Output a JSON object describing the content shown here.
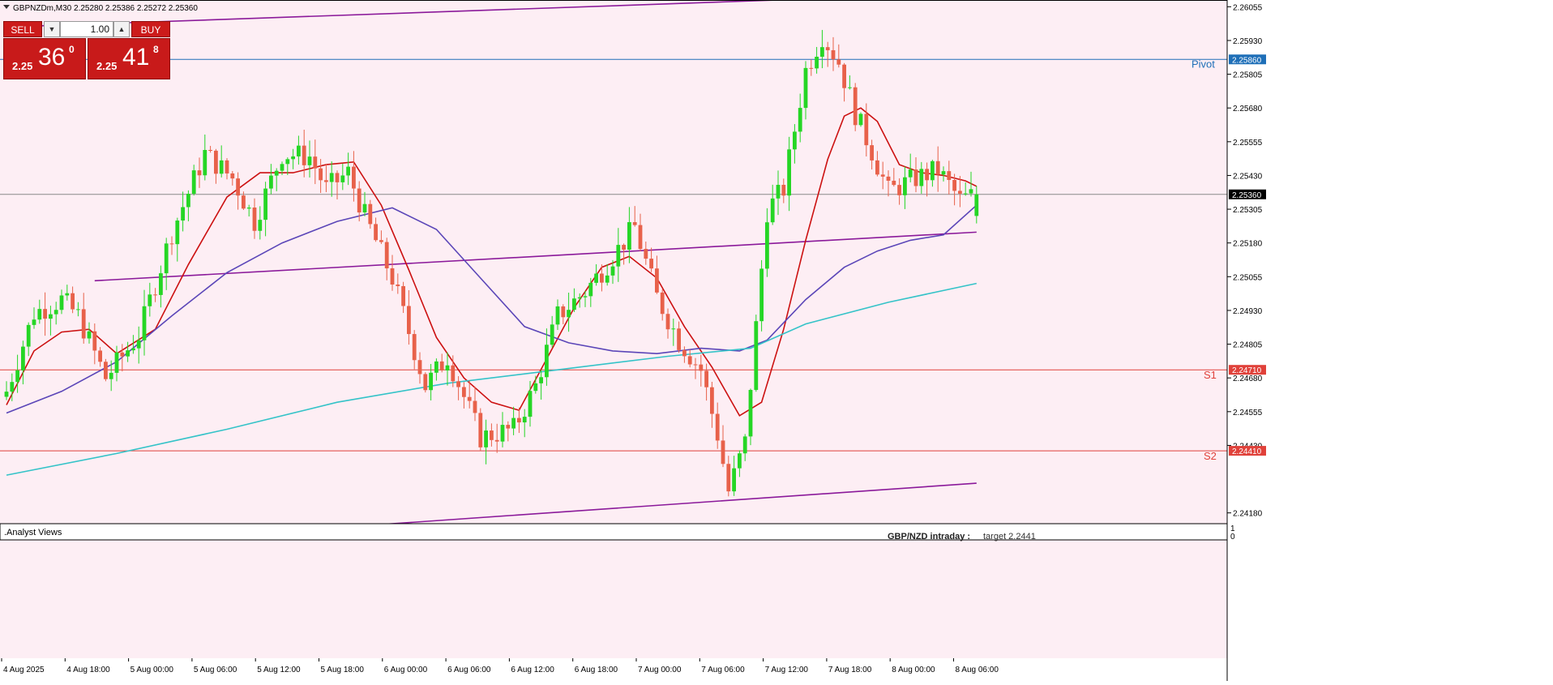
{
  "header": {
    "symbol_line": "GBPNZDm,M30  2.25280 2.25386 2.25272 2.25360"
  },
  "trade_panel": {
    "sell_label": "SELL",
    "buy_label": "BUY",
    "lot_value": "1.00",
    "sell_small": "2.25",
    "sell_big": "36",
    "sell_sup": "0",
    "buy_small": "2.25",
    "buy_big": "41",
    "buy_sup": "8",
    "spin_down_icon": "triangle-down-icon",
    "spin_up_icon": "triangle-up-icon"
  },
  "levels": {
    "pivot": {
      "label": "Pivot",
      "value": "2.25860",
      "color": "#1e6fb8"
    },
    "s1": {
      "label": "S1",
      "value": "2.24710",
      "color": "#e0413a"
    },
    "s2": {
      "label": "S2",
      "value": "2.24410",
      "color": "#e0413a"
    },
    "current": {
      "value": "2.25360"
    }
  },
  "subwindow": {
    "title": ".Analyst Views",
    "annotation_label": "GBP/NZD intraday :",
    "annotation_value": "target 2.2441",
    "scale_top": "1",
    "scale_bottom": "0"
  },
  "colors": {
    "background": "#fdeef4",
    "bull": "#25d625",
    "bear": "#e8614a",
    "ma_fast": "#cc1111",
    "ma_mid": "#5b46b8",
    "ma_slow": "#34c3c8",
    "channel": "#8b1a9a"
  },
  "chart_data": {
    "type": "candlestick",
    "symbol": "GBPNZDm",
    "timeframe": "M30",
    "ohlc_current": {
      "open": 2.2528,
      "high": 2.25386,
      "low": 2.25272,
      "close": 2.2536
    },
    "y_axis": {
      "ticks": [
        2.26055,
        2.2593,
        2.25805,
        2.2568,
        2.25555,
        2.2543,
        2.25305,
        2.2518,
        2.25055,
        2.2493,
        2.24805,
        2.2468,
        2.24555,
        2.2443,
        2.2418
      ],
      "ylim": [
        2.2414,
        2.2608
      ]
    },
    "x_axis": {
      "ticks": [
        "4 Aug 2025",
        "4 Aug 18:00",
        "5 Aug 00:00",
        "5 Aug 06:00",
        "5 Aug 12:00",
        "5 Aug 18:00",
        "6 Aug 00:00",
        "6 Aug 06:00",
        "6 Aug 12:00",
        "6 Aug 18:00",
        "7 Aug 00:00",
        "7 Aug 06:00",
        "7 Aug 12:00",
        "7 Aug 18:00",
        "8 Aug 00:00",
        "8 Aug 06:00"
      ]
    },
    "horizontal_levels": [
      {
        "name": "Pivot",
        "value": 2.2586
      },
      {
        "name": "S1",
        "value": 2.2471
      },
      {
        "name": "S2",
        "value": 2.2441
      },
      {
        "name": "current",
        "value": 2.2536
      }
    ],
    "anchors": [
      {
        "t": 0,
        "p": 2.2463
      },
      {
        "t": 5,
        "p": 2.2492
      },
      {
        "t": 10,
        "p": 2.2497
      },
      {
        "t": 13,
        "p": 2.2491
      },
      {
        "t": 18,
        "p": 2.2468
      },
      {
        "t": 24,
        "p": 2.2484
      },
      {
        "t": 30,
        "p": 2.2522
      },
      {
        "t": 36,
        "p": 2.2551
      },
      {
        "t": 41,
        "p": 2.2542
      },
      {
        "t": 45,
        "p": 2.2526
      },
      {
        "t": 50,
        "p": 2.2551
      },
      {
        "t": 55,
        "p": 2.255
      },
      {
        "t": 58,
        "p": 2.2538
      },
      {
        "t": 62,
        "p": 2.2544
      },
      {
        "t": 65,
        "p": 2.2528
      },
      {
        "t": 70,
        "p": 2.2505
      },
      {
        "t": 76,
        "p": 2.2465
      },
      {
        "t": 80,
        "p": 2.2476
      },
      {
        "t": 86,
        "p": 2.2446
      },
      {
        "t": 92,
        "p": 2.2449
      },
      {
        "t": 96,
        "p": 2.2465
      },
      {
        "t": 100,
        "p": 2.2491
      },
      {
        "t": 105,
        "p": 2.25
      },
      {
        "t": 110,
        "p": 2.2513
      },
      {
        "t": 114,
        "p": 2.2524
      },
      {
        "t": 118,
        "p": 2.2498
      },
      {
        "t": 122,
        "p": 2.2482
      },
      {
        "t": 126,
        "p": 2.2471
      },
      {
        "t": 129,
        "p": 2.2447
      },
      {
        "t": 131,
        "p": 2.2426
      },
      {
        "t": 134,
        "p": 2.2444
      },
      {
        "t": 138,
        "p": 2.253
      },
      {
        "t": 141,
        "p": 2.2538
      },
      {
        "t": 145,
        "p": 2.2582
      },
      {
        "t": 148,
        "p": 2.2595
      },
      {
        "t": 151,
        "p": 2.2585
      },
      {
        "t": 154,
        "p": 2.2566
      },
      {
        "t": 157,
        "p": 2.2552
      },
      {
        "t": 160,
        "p": 2.2537
      },
      {
        "t": 165,
        "p": 2.2542
      },
      {
        "t": 169,
        "p": 2.2545
      },
      {
        "t": 173,
        "p": 2.2534
      },
      {
        "t": 176,
        "p": 2.2536
      }
    ],
    "moving_averages": [
      {
        "name": "fast",
        "color": "#cc1111",
        "points": [
          [
            0,
            2.2458
          ],
          [
            5,
            2.2478
          ],
          [
            10,
            2.2485
          ],
          [
            15,
            2.2486
          ],
          [
            20,
            2.2477
          ],
          [
            27,
            2.2486
          ],
          [
            33,
            2.251
          ],
          [
            40,
            2.2535
          ],
          [
            46,
            2.2544
          ],
          [
            52,
            2.2544
          ],
          [
            58,
            2.2547
          ],
          [
            63,
            2.2548
          ],
          [
            68,
            2.2532
          ],
          [
            73,
            2.2508
          ],
          [
            78,
            2.2483
          ],
          [
            83,
            2.2468
          ],
          [
            88,
            2.2459
          ],
          [
            93,
            2.2456
          ],
          [
            98,
            2.2475
          ],
          [
            103,
            2.2494
          ],
          [
            108,
            2.2509
          ],
          [
            113,
            2.2513
          ],
          [
            118,
            2.2505
          ],
          [
            123,
            2.2487
          ],
          [
            128,
            2.2472
          ],
          [
            133,
            2.2454
          ],
          [
            137,
            2.2459
          ],
          [
            141,
            2.2486
          ],
          [
            145,
            2.2519
          ],
          [
            149,
            2.2549
          ],
          [
            152,
            2.2565
          ],
          [
            155,
            2.2568
          ],
          [
            158,
            2.2563
          ],
          [
            162,
            2.2547
          ],
          [
            166,
            2.2544
          ],
          [
            170,
            2.2543
          ],
          [
            174,
            2.2541
          ],
          [
            176,
            2.2539
          ]
        ]
      },
      {
        "name": "mid",
        "color": "#5b46b8",
        "points": [
          [
            0,
            2.2455
          ],
          [
            10,
            2.2463
          ],
          [
            20,
            2.2474
          ],
          [
            30,
            2.2491
          ],
          [
            40,
            2.2507
          ],
          [
            50,
            2.2518
          ],
          [
            60,
            2.2526
          ],
          [
            70,
            2.2531
          ],
          [
            78,
            2.2523
          ],
          [
            86,
            2.2505
          ],
          [
            94,
            2.2487
          ],
          [
            102,
            2.2481
          ],
          [
            110,
            2.2478
          ],
          [
            118,
            2.2477
          ],
          [
            126,
            2.2479
          ],
          [
            133,
            2.2478
          ],
          [
            138,
            2.2482
          ],
          [
            145,
            2.2497
          ],
          [
            152,
            2.2509
          ],
          [
            158,
            2.2515
          ],
          [
            164,
            2.2519
          ],
          [
            170,
            2.2521
          ],
          [
            176,
            2.2532
          ]
        ]
      },
      {
        "name": "slow",
        "color": "#34c3c8",
        "points": [
          [
            0,
            2.2432
          ],
          [
            20,
            2.244
          ],
          [
            40,
            2.2449
          ],
          [
            60,
            2.2459
          ],
          [
            80,
            2.2466
          ],
          [
            100,
            2.2471
          ],
          [
            120,
            2.2476
          ],
          [
            135,
            2.2479
          ],
          [
            145,
            2.2488
          ],
          [
            160,
            2.2496
          ],
          [
            176,
            2.2503
          ]
        ]
      }
    ],
    "channel_lines": [
      {
        "from": [
          0,
          2.2598
        ],
        "to": [
          140,
          2.2608
        ]
      },
      {
        "from": [
          16,
          2.2504
        ],
        "to": [
          176,
          2.2522
        ]
      },
      {
        "from": [
          63,
          2.2413
        ],
        "to": [
          176,
          2.2429
        ]
      }
    ]
  }
}
